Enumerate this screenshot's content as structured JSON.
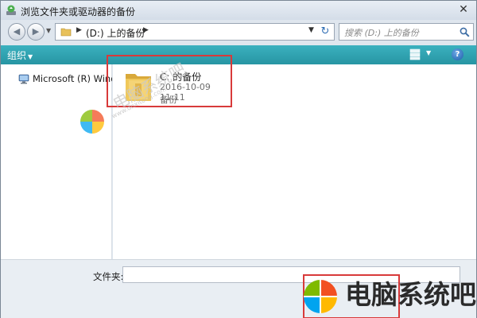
{
  "window": {
    "title": "浏览文件夹或驱动器的备份",
    "close_glyph": "✕"
  },
  "address": {
    "path": "(D:) 上的备份",
    "search_placeholder": "搜索 (D:) 上的备份"
  },
  "toolbar": {
    "organize_label": "组织"
  },
  "navigation": {
    "items": [
      {
        "label": "Microsoft (R) Windows",
        "icon": "computer-icon"
      }
    ]
  },
  "files": [
    {
      "name": "C: 的备份",
      "date": "2016-10-09 11:11",
      "type": "备份",
      "icon": "backup-folder-icon"
    }
  ],
  "bottom": {
    "folder_label": "文件夹:",
    "folder_value": ""
  },
  "watermark": {
    "text": "电脑系统吧",
    "sub": "www.dnxitong.com"
  },
  "brand": {
    "text": "电脑系统吧",
    "url": "www.dnxitong.com"
  },
  "colors": {
    "toolbar": "#2795a3",
    "highlight": "#d83a3a"
  }
}
